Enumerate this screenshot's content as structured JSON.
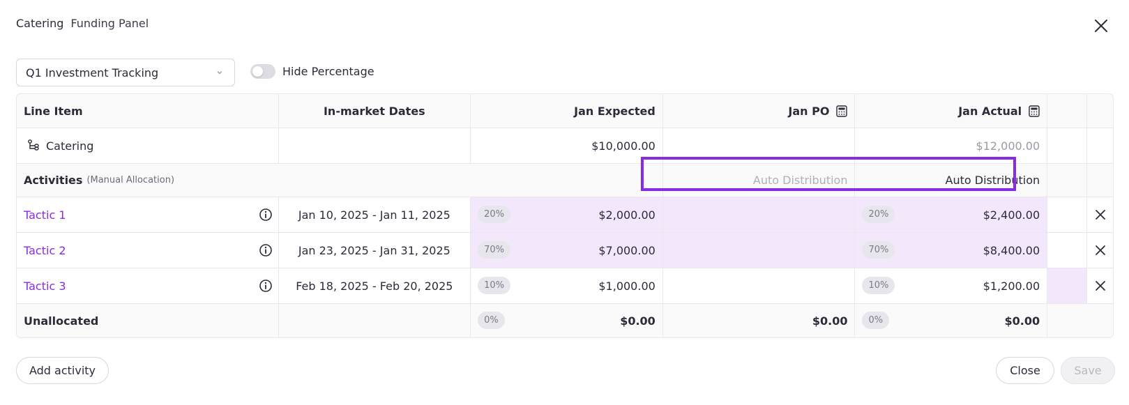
{
  "header": {
    "breadcrumb_primary": "Catering",
    "breadcrumb_secondary": "Funding Panel"
  },
  "toolbar": {
    "view_select": "Q1 Investment Tracking",
    "toggle_label": "Hide Percentage",
    "toggle_on": false
  },
  "table": {
    "columns": {
      "line_item": "Line Item",
      "dates": "In-market Dates",
      "jan_expected": "Jan Expected",
      "jan_po": "Jan PO",
      "jan_actual": "Jan Actual"
    },
    "catering_row": {
      "label": "Catering",
      "jan_expected": "$10,000.00",
      "jan_actual": "$12,000.00"
    },
    "activities_row": {
      "label": "Activities",
      "sub": "(Manual Allocation)",
      "po_distribution": "Auto Distribution",
      "actual_distribution": "Auto Distribution"
    },
    "tactics": [
      {
        "name": "Tactic 1",
        "dates": "Jan 10, 2025 - Jan 11, 2025",
        "exp_pct": "20%",
        "exp_val": "$2,000.00",
        "act_pct": "20%",
        "act_val": "$2,400.00"
      },
      {
        "name": "Tactic 2",
        "dates": "Jan 23, 2025 - Jan 31, 2025",
        "exp_pct": "70%",
        "exp_val": "$7,000.00",
        "act_pct": "70%",
        "act_val": "$8,400.00"
      },
      {
        "name": "Tactic 3",
        "dates": "Feb 18, 2025 - Feb 20, 2025",
        "exp_pct": "10%",
        "exp_val": "$1,000.00",
        "act_pct": "10%",
        "act_val": "$1,200.00"
      }
    ],
    "unallocated": {
      "label": "Unallocated",
      "exp_pct": "0%",
      "exp_val": "$0.00",
      "po_val": "$0.00",
      "act_pct": "0%",
      "act_val": "$0.00"
    }
  },
  "footer": {
    "add_label": "Add activity",
    "close_label": "Close",
    "save_label": "Save"
  },
  "colors": {
    "accent": "#8a2be2",
    "highlight_fill": "#f3e8fb"
  }
}
